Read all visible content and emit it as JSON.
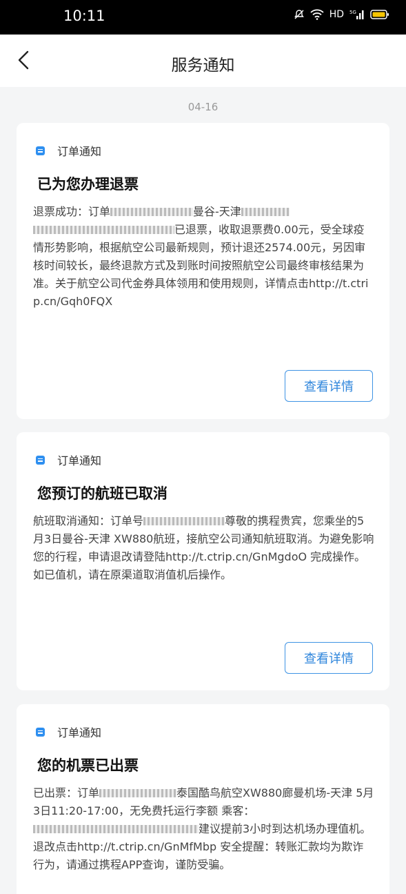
{
  "status_bar": {
    "time": "10:11",
    "network": "HD",
    "signal_label": "5G"
  },
  "nav": {
    "title": "服务通知"
  },
  "date": "04-16",
  "cards": [
    {
      "type": "订单通知",
      "title": "已为您办理退票",
      "body_p1": "退票成功：订单",
      "body_p2": "曼谷-天津",
      "body_p3": "已退票，收取退票费0.00元，受全球疫情形势影响，根据航空公司最新规则，预计退还2574.00元，另因审核时间较长，最终退款方式及到账时间按照航空公司最终审核结果为准。关于航空公司代金券具体领用和使用规则，详情点击http://t.ctrip.cn/Gqh0FQX",
      "button": "查看详情"
    },
    {
      "type": "订单通知",
      "title": "您预订的航班已取消",
      "body_p1": "航班取消通知：订单号",
      "body_p2": "尊敬的携程贵宾，您乘坐的5月3日曼谷-天津 XW880航班，接航空公司通知航班取消。为避免影响您的行程，申请退改请登陆http://t.ctrip.cn/GnMgdoO 完成操作。如已值机，请在原渠道取消值机后操作。",
      "button": "查看详情"
    },
    {
      "type": "订单通知",
      "title": "您的机票已出票",
      "body_p1": "已出票：订单",
      "body_p2": "泰国酷鸟航空XW880廊曼机场-天津 5月3日11:20-17:00，无免费托运行李额 乘客：",
      "body_p3": "建议提前3小时到达机场办理值机。退改点击http://t.ctrip.cn/GnMfMbp 安全提醒：转账汇款均为欺诈行为，请通过携程APP查询，谨防受骗。"
    }
  ]
}
